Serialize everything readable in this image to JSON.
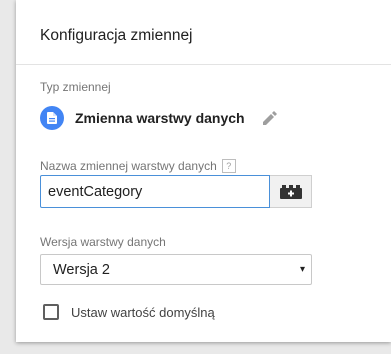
{
  "dialog": {
    "title": "Konfiguracja zmiennej"
  },
  "variable_type": {
    "label": "Typ zmiennej",
    "name": "Zmienna warstwy danych",
    "icon": "document-icon",
    "icon_color": "#4285f4",
    "edit_icon": "pencil-icon"
  },
  "datalayer_variable_name": {
    "label": "Nazwa zmiennej warstwy danych",
    "help": "?",
    "value": "eventCategory",
    "button_icon": "variable-brick-icon"
  },
  "datalayer_version": {
    "label": "Wersja warstwy danych",
    "selected": "Wersja 2",
    "arrow": "▾"
  },
  "default_value": {
    "label": "Ustaw wartość domyślną",
    "checked": false
  },
  "colors": {
    "accent": "#4285f4",
    "focus_border": "#4a90d9"
  }
}
